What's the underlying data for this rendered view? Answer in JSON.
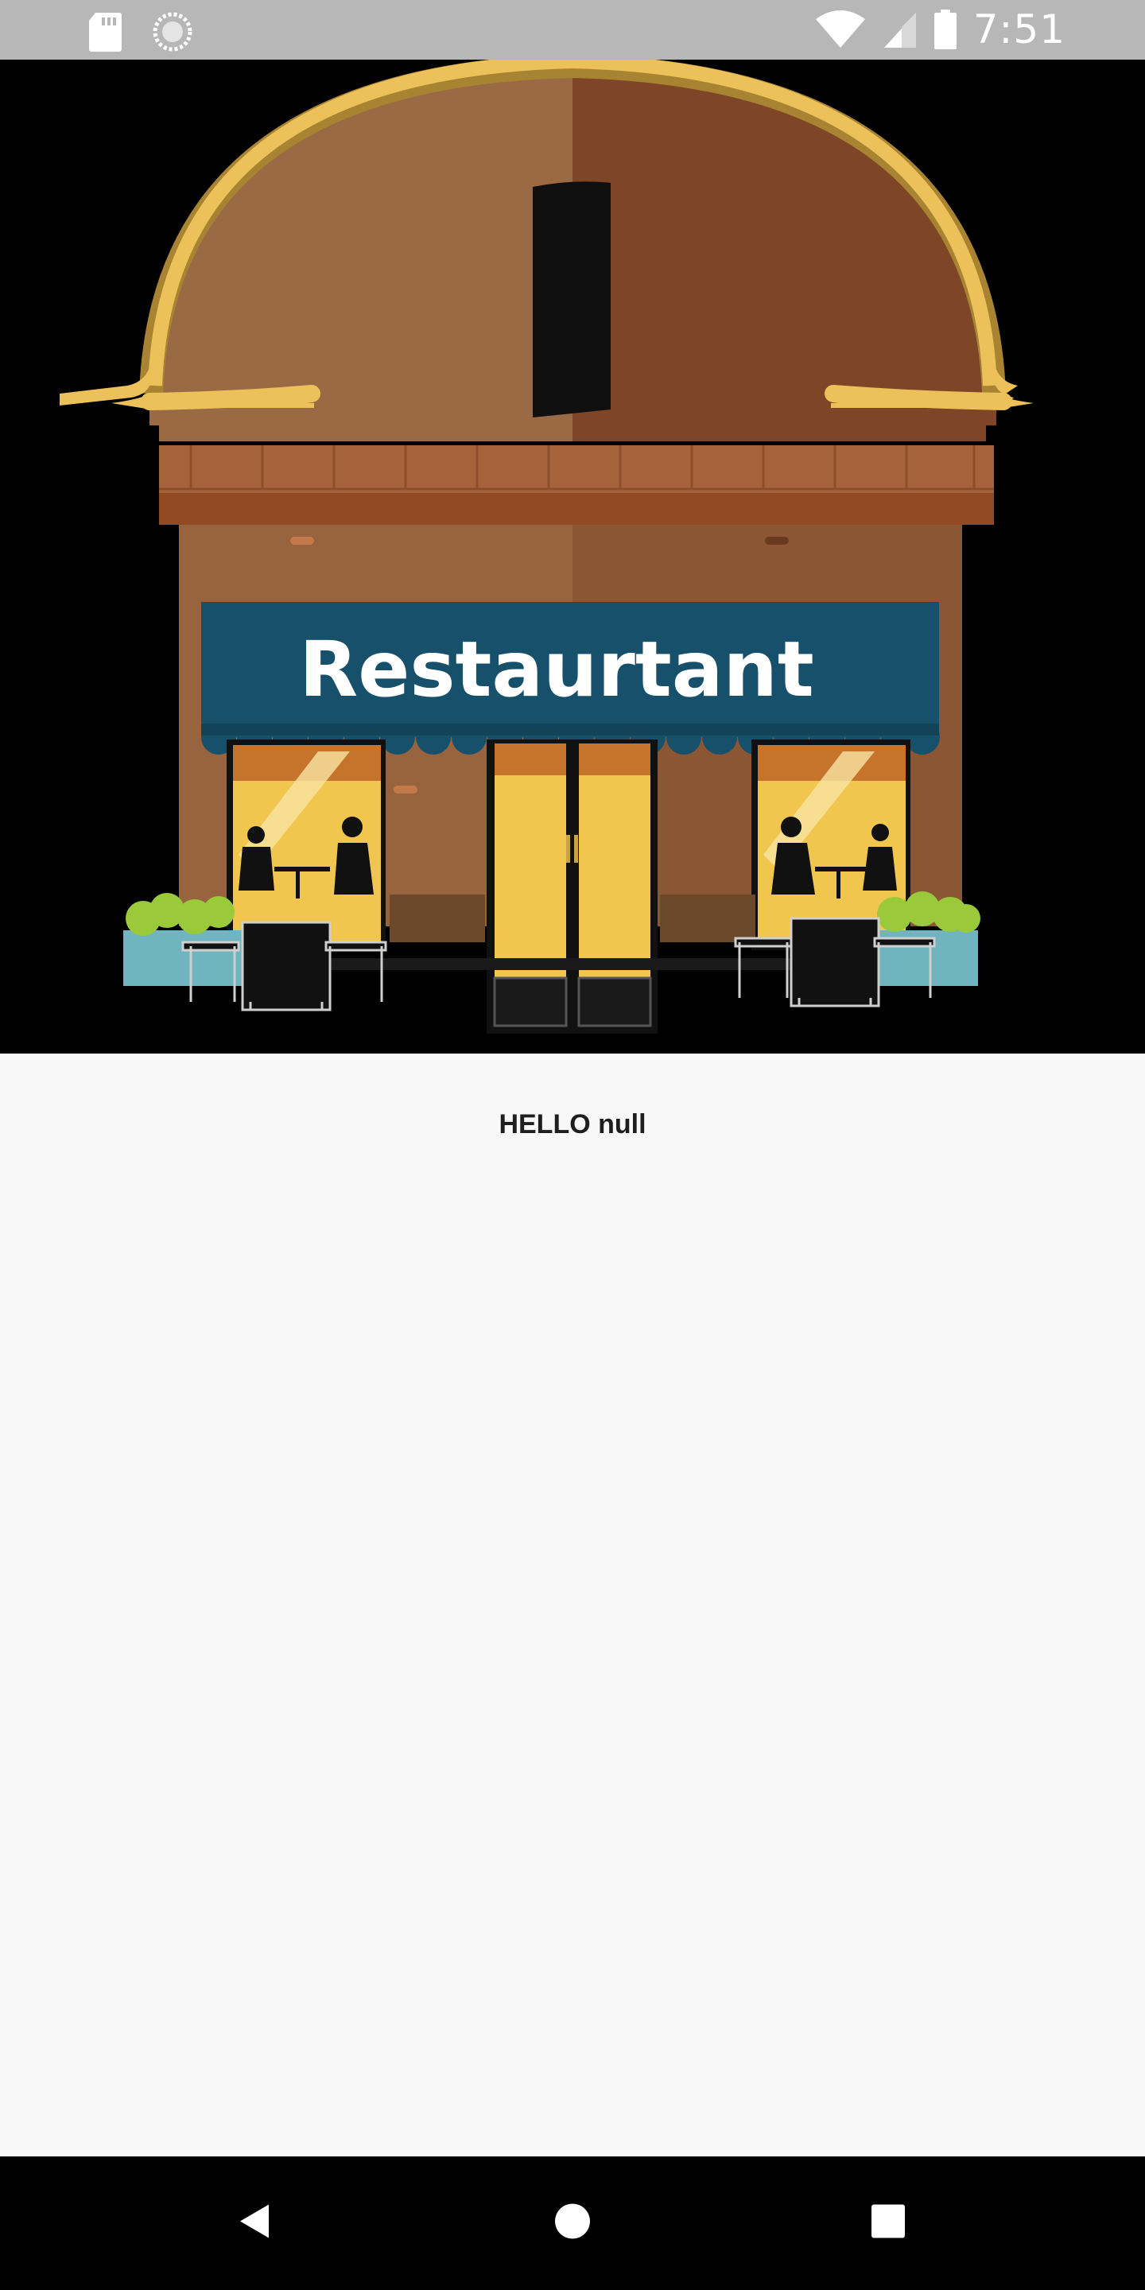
{
  "status_bar": {
    "time": "7:51",
    "icons": [
      "sd-card-icon",
      "loading-icon",
      "wifi-icon",
      "signal-icon",
      "battery-icon"
    ]
  },
  "hero": {
    "sign_text": "Restaurtant"
  },
  "main": {
    "greeting": "HELLO null"
  },
  "nav_bar": {
    "buttons": [
      "back-icon",
      "home-icon",
      "recents-icon"
    ]
  },
  "colors": {
    "status_bar": "#b7b7b7",
    "background": "#f8f8f8",
    "awning": "#16506b",
    "arch_trim": "#ecc15a"
  }
}
